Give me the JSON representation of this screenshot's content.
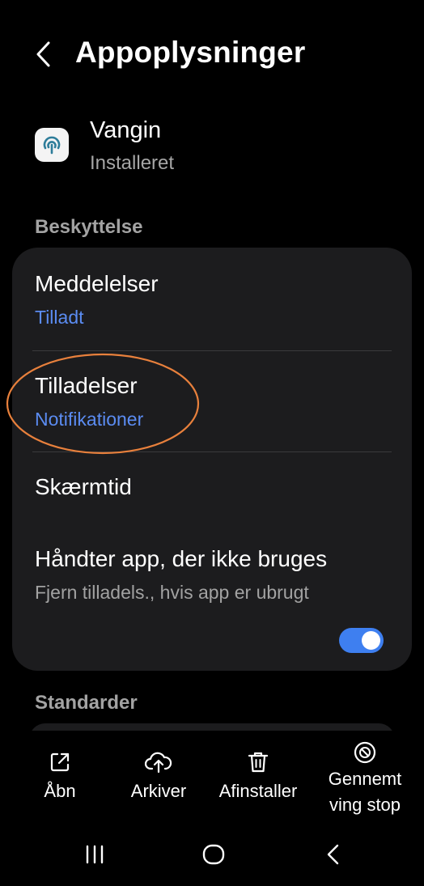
{
  "header": {
    "title": "Appoplysninger"
  },
  "app": {
    "name": "Vangin",
    "status": "Installeret"
  },
  "sections": {
    "protection": "Beskyttelse",
    "defaults": "Standarder"
  },
  "rows": {
    "notifications": {
      "title": "Meddelelser",
      "subtitle": "Tilladt"
    },
    "permissions": {
      "title": "Tilladelser",
      "subtitle": "Notifikationer"
    },
    "screen_time": {
      "title": "Skærmtid"
    },
    "unused": {
      "title": "Håndter app, der ikke bruges",
      "subtitle": "Fjern tilladels., hvis app er ubrugt",
      "toggle_on": true
    }
  },
  "actions": {
    "open": "Åbn",
    "archive": "Arkiver",
    "uninstall": "Afinstaller",
    "force_stop_line1": "Gennemt",
    "force_stop_line2": "ving stop"
  },
  "icons": {
    "back": "chevron-left-icon",
    "app": "app-logo-icon",
    "open": "open-external-icon",
    "archive": "cloud-upload-icon",
    "uninstall": "trash-icon",
    "force_stop": "stop-icon",
    "nav_recents": "recents-icon",
    "nav_home": "home-icon",
    "nav_back": "nav-back-icon"
  },
  "colors": {
    "accent": "#5b8cf2",
    "toggle": "#3e7ff0",
    "card": "#1c1c1e",
    "annotation": "#e8803c"
  }
}
